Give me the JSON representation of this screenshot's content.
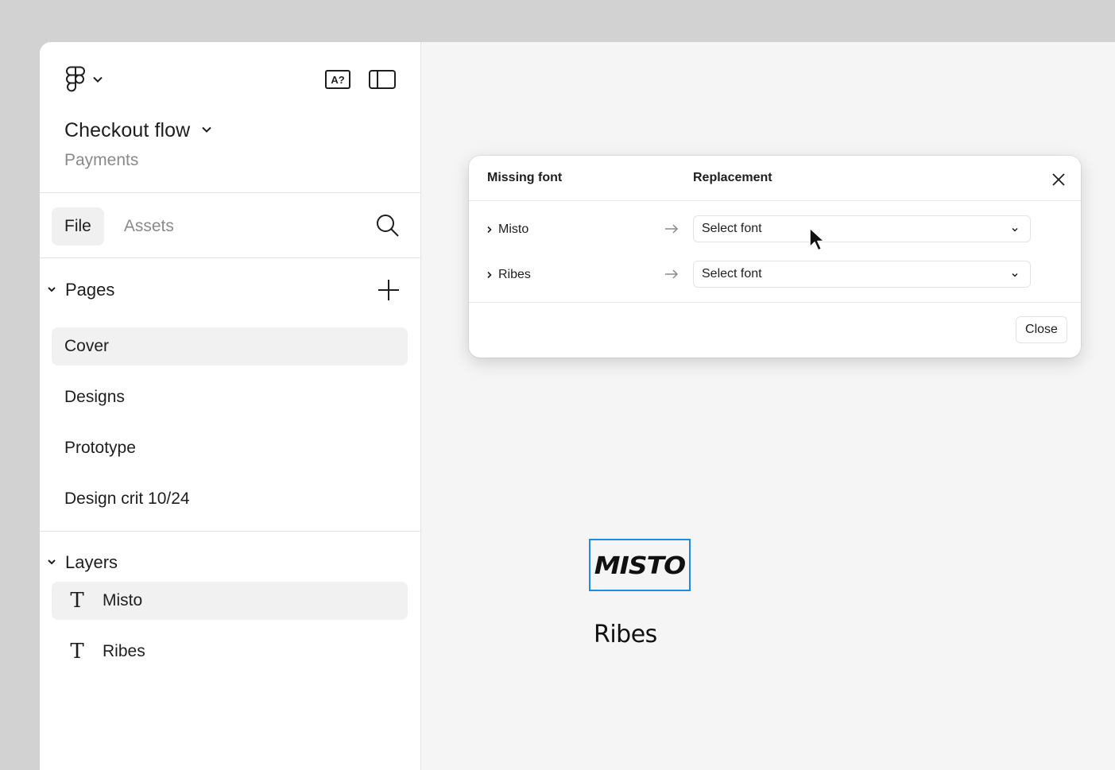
{
  "sidebar": {
    "file_title": "Checkout flow",
    "project_name": "Payments",
    "font_badge": "A?",
    "tabs": [
      {
        "label": "File"
      },
      {
        "label": "Assets"
      }
    ],
    "pages_section": {
      "label": "Pages",
      "items": [
        {
          "label": "Cover",
          "selected": true
        },
        {
          "label": "Designs"
        },
        {
          "label": "Prototype"
        },
        {
          "label": "Design crit 10/24"
        }
      ]
    },
    "layers_section": {
      "label": "Layers",
      "items": [
        {
          "label": "Misto",
          "type": "text",
          "selected": true
        },
        {
          "label": "Ribes",
          "type": "text"
        }
      ]
    }
  },
  "dialog": {
    "col_missing": "Missing font",
    "col_replacement": "Replacement",
    "rows": [
      {
        "font": "Misto",
        "placeholder": "Select font"
      },
      {
        "font": "Ribes",
        "placeholder": "Select font"
      }
    ],
    "close_label": "Close"
  },
  "canvas": {
    "text_layers": [
      {
        "text": "MISTO"
      },
      {
        "text": "Ribes"
      }
    ]
  },
  "colors": {
    "selection": "#1e8ce4",
    "canvas_bg": "#f5f5f5",
    "sidebar_bg": "#ffffff",
    "muted_text": "#8a8a8a"
  },
  "icons": {
    "logo": "figma-logo-icon",
    "missing_font": "missing-font-icon",
    "panel": "panel-toggle-icon",
    "search": "search-icon",
    "add": "plus-icon",
    "close": "close-icon"
  }
}
